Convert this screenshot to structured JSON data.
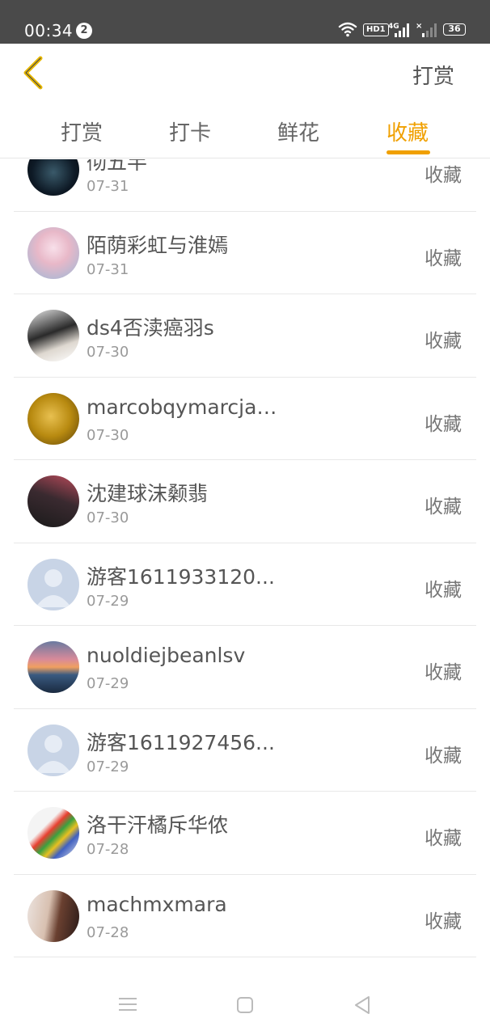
{
  "status_bar": {
    "time": "00:34",
    "notification_count": "2",
    "network_hd": "HD1",
    "network_type": "4G",
    "battery": "36"
  },
  "header": {
    "action_label": "打赏"
  },
  "tabs": [
    {
      "label": "打赏",
      "active": false
    },
    {
      "label": "打卡",
      "active": false
    },
    {
      "label": "鲜花",
      "active": false
    },
    {
      "label": "收藏",
      "active": true
    }
  ],
  "accent_color": "#f0a000",
  "list": [
    {
      "name": "彻五半",
      "date": "07-31",
      "action": "收藏",
      "avatar": "dark-fish-avatar"
    },
    {
      "name": "陌荫彩虹与淮嫣",
      "date": "07-31",
      "action": "收藏",
      "avatar": "anime-girl-avatar"
    },
    {
      "name": "ds4否渎癌羽s",
      "date": "07-30",
      "action": "收藏",
      "avatar": "boy-photo-avatar"
    },
    {
      "name": "marcobqymarcjaf...",
      "date": "07-30",
      "action": "收藏",
      "avatar": "golden-flower-avatar"
    },
    {
      "name": "沈建球沫颡翡",
      "date": "07-30",
      "action": "收藏",
      "avatar": "girl-photo-avatar"
    },
    {
      "name": "游客1611933120...",
      "date": "07-29",
      "action": "收藏",
      "avatar": "default-user-avatar"
    },
    {
      "name": "nuoldiejbeanlsv",
      "date": "07-29",
      "action": "收藏",
      "avatar": "sunset-lake-avatar"
    },
    {
      "name": "游客1611927456...",
      "date": "07-29",
      "action": "收藏",
      "avatar": "default-user-avatar"
    },
    {
      "name": "洛干汗橘斥华侬",
      "date": "07-28",
      "action": "收藏",
      "avatar": "color-pencils-avatar"
    },
    {
      "name": "machmxmara",
      "date": "07-28",
      "action": "收藏",
      "avatar": "woman-photo-avatar"
    }
  ]
}
